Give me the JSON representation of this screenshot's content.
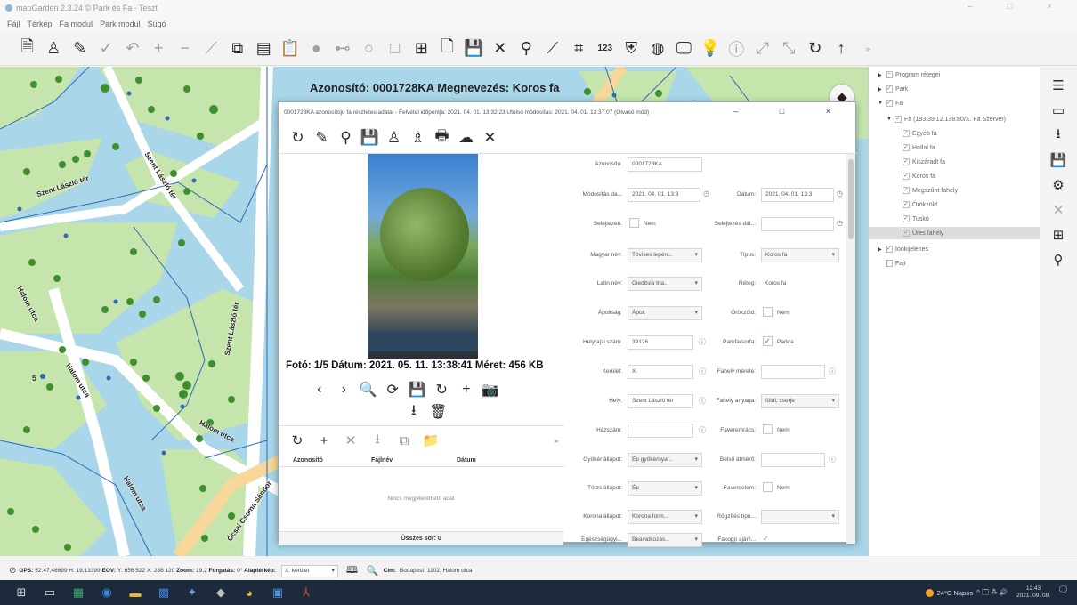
{
  "window": {
    "title": "mapGarden 2.3.24 © Park és Fa - Teszt",
    "controls": "–  □  ×"
  },
  "menu": [
    "Fájl",
    "Térkép",
    "Fa modul",
    "Park modul",
    "Súgó"
  ],
  "toolbar": {
    "icons": [
      "new-document-icon",
      "worker-icon",
      "pencil-icon",
      "check-icon",
      "undo-icon",
      "plus-icon",
      "minus-icon",
      "line-icon",
      "copy-icon",
      "paste-icon",
      "clipboard-icon",
      "dot-icon",
      "segment-icon",
      "circle-icon",
      "square-icon",
      "grid-icon",
      "add-page-icon",
      "save-icon",
      "close-icon",
      "surveyor-icon",
      "measure-icon",
      "nodes-icon",
      "numbers-icon",
      "shield-check-icon",
      "globe-icon",
      "monitor-icon",
      "bulb-icon",
      "alert-icon",
      "expand-icon",
      "collapse-icon",
      "refresh-icon",
      "arrow-up-icon"
    ],
    "numbers_label": "123",
    "more": "»"
  },
  "map": {
    "title": "Azonosító: 0001728KA Megnevezés: Koros fa",
    "streets": [
      "Szent László tér",
      "Szent László tér",
      "Halom utca",
      "Halom utca",
      "Szent László tér",
      "Halom utca",
      "Halom utca",
      "Ócsai Csoma Sándor"
    ],
    "label_5": "5"
  },
  "tree": {
    "items": [
      {
        "label": "Program rétegei",
        "checked": false,
        "arrow": "▶"
      },
      {
        "label": "Park",
        "checked": true,
        "arrow": "▶"
      },
      {
        "label": "Fa",
        "checked": true,
        "arrow": "▼"
      },
      {
        "label": "Fa (193.39.12.138:80/X. Fa Szerver)",
        "checked": true,
        "arrow": "▼"
      },
      {
        "label": "Egyéb fa",
        "checked": true,
        "arrow": ""
      },
      {
        "label": "Hatlal fa",
        "checked": true,
        "arrow": ""
      },
      {
        "label": "Kiszáradt fa",
        "checked": true,
        "arrow": ""
      },
      {
        "label": "Koros fa",
        "checked": true,
        "arrow": ""
      },
      {
        "label": "Megszűnt fahely",
        "checked": true,
        "arrow": ""
      },
      {
        "label": "Örökzöld",
        "checked": true,
        "arrow": ""
      },
      {
        "label": "Tuskó",
        "checked": true,
        "arrow": ""
      },
      {
        "label": "Üres fahely",
        "checked": true,
        "arrow": ""
      },
      {
        "label": "Ionkijelenes",
        "checked": true,
        "arrow": "▶"
      },
      {
        "label": "Fajt",
        "checked": false,
        "arrow": ""
      }
    ]
  },
  "side_toolbar": [
    "list-icon",
    "message-icon",
    "download-icon",
    "save-icon",
    "settings-icon",
    "close-icon",
    "table-icon",
    "location-pin-icon"
  ],
  "dialog": {
    "title": "0001728KA azonosítójú fa részletes adatai - Felvétel időpontja: 2021. 04. 01. 13:32:23 Utolsó módosítás: 2021. 04. 01. 13:37:07 (Olvasó mód)",
    "controls": "–  □  ×",
    "toolbar_icons": [
      "refresh-icon",
      "pencil-icon",
      "location-pin-icon",
      "save-icon",
      "worker-icon",
      "surveyor-icon",
      "print-icon",
      "cloud-upload-icon",
      "close-icon"
    ],
    "photo_caption": "Fotó: 1/5 Dátum: 2021. 05. 11. 13:38:41 Méret: 456 KB",
    "photo_nav": [
      "‹",
      "›",
      "🔍",
      "⟳",
      "💾",
      "↻",
      "+",
      "📷"
    ],
    "photo_nav2": [
      "⭳",
      "🗑"
    ],
    "files": {
      "toolbar": [
        "↻",
        "+",
        "✕",
        "⭳",
        "⧉",
        "📁"
      ],
      "more": "»",
      "col_id": "Azonosító",
      "col_name": "Fájlnév",
      "col_date": "Dátum",
      "empty": "Nincs megjeleníthető adat",
      "footer": "Összes sor: 0"
    },
    "form": {
      "id_label": "Azonosító:",
      "id_value": "0001728KA",
      "mod_label": "Módosítás da...",
      "mod_value": "2021. 04. 01. 13:3",
      "date_label": "Dátum:",
      "date_value": "2021. 04. 01. 13:3",
      "sel_label": "Selejtezett:",
      "sel_text": "Nem",
      "seldate_label": "Selejtezés dát...",
      "hun_label": "Magyar név:",
      "hun_value": "Tövises lepén...",
      "type_label": "Típus:",
      "type_value": "Koros fa",
      "latin_label": "Latin név:",
      "latin_value": "Gleditsia tria...",
      "layer_label": "Réteg:",
      "layer_value": "Koros fa",
      "care_label": "Ápoltság:",
      "care_value": "Ápolt",
      "evergreen_label": "Örökzöld:",
      "evergreen_text": "Nem",
      "lot_label": "Helyrajzi szám:",
      "lot_value": "39126",
      "parkrow_label": "Parkfa/sorfa:",
      "parkrow_text": "Parkfa",
      "district_label": "Kerület:",
      "district_value": "X.",
      "pitsize_label": "Fahely mérete:",
      "place_label": "Hely:",
      "place_value": "Szent László tér",
      "pitmat_label": "Fahely anyaga:",
      "pitmat_value": "földi, cserje",
      "house_label": "Házszám:",
      "grate_label": "Faveremrács:",
      "grate_text": "Nem",
      "root_label": "Gyökér állapot:",
      "root_value": "Ép gyökérnya...",
      "inner_label": "Belső átmérő:",
      "trunk_label": "Törzs állapot:",
      "trunk_value": "Ép",
      "cover_label": "Faverdelem:",
      "cover_text": "Nem",
      "crown_label": "Korona állapot:",
      "crown_value": "Korona form...",
      "fix_label": "Rögzítés típu...",
      "health_label": "Egészségügyi...",
      "health_value": "Beavatkozás...",
      "cut_label": "Fakopp ajánl..."
    }
  },
  "status": {
    "gps_label": "GPS:",
    "gps_value": "52.47,48699 H: 19,13399",
    "eov_label": "EOV:",
    "eov_value": "Y: 656 522 X: 238 120",
    "zoom_label": "Zoom:",
    "zoom_value": "19,2",
    "rot_label": "Forgatás:",
    "rot_value": "0°",
    "base_label": "Alaptérkép:",
    "base_value": "X. kerület",
    "addr_label": "Cím:",
    "addr_value": "Budapest, 1102, Halom utca"
  },
  "taskbar": {
    "weather": "24°C Napos",
    "tray": "^ 🗔 ⁂ 🔊",
    "time": "12:43",
    "date": "2021. 09. 08."
  },
  "colors": {
    "map_water": "#a9d6e9",
    "map_park": "#c5e5ad",
    "map_road": "#ffffff",
    "road_line": "#2f69b8",
    "tree_green": "#3f8f2f",
    "taskbar": "#1c2a3c"
  }
}
